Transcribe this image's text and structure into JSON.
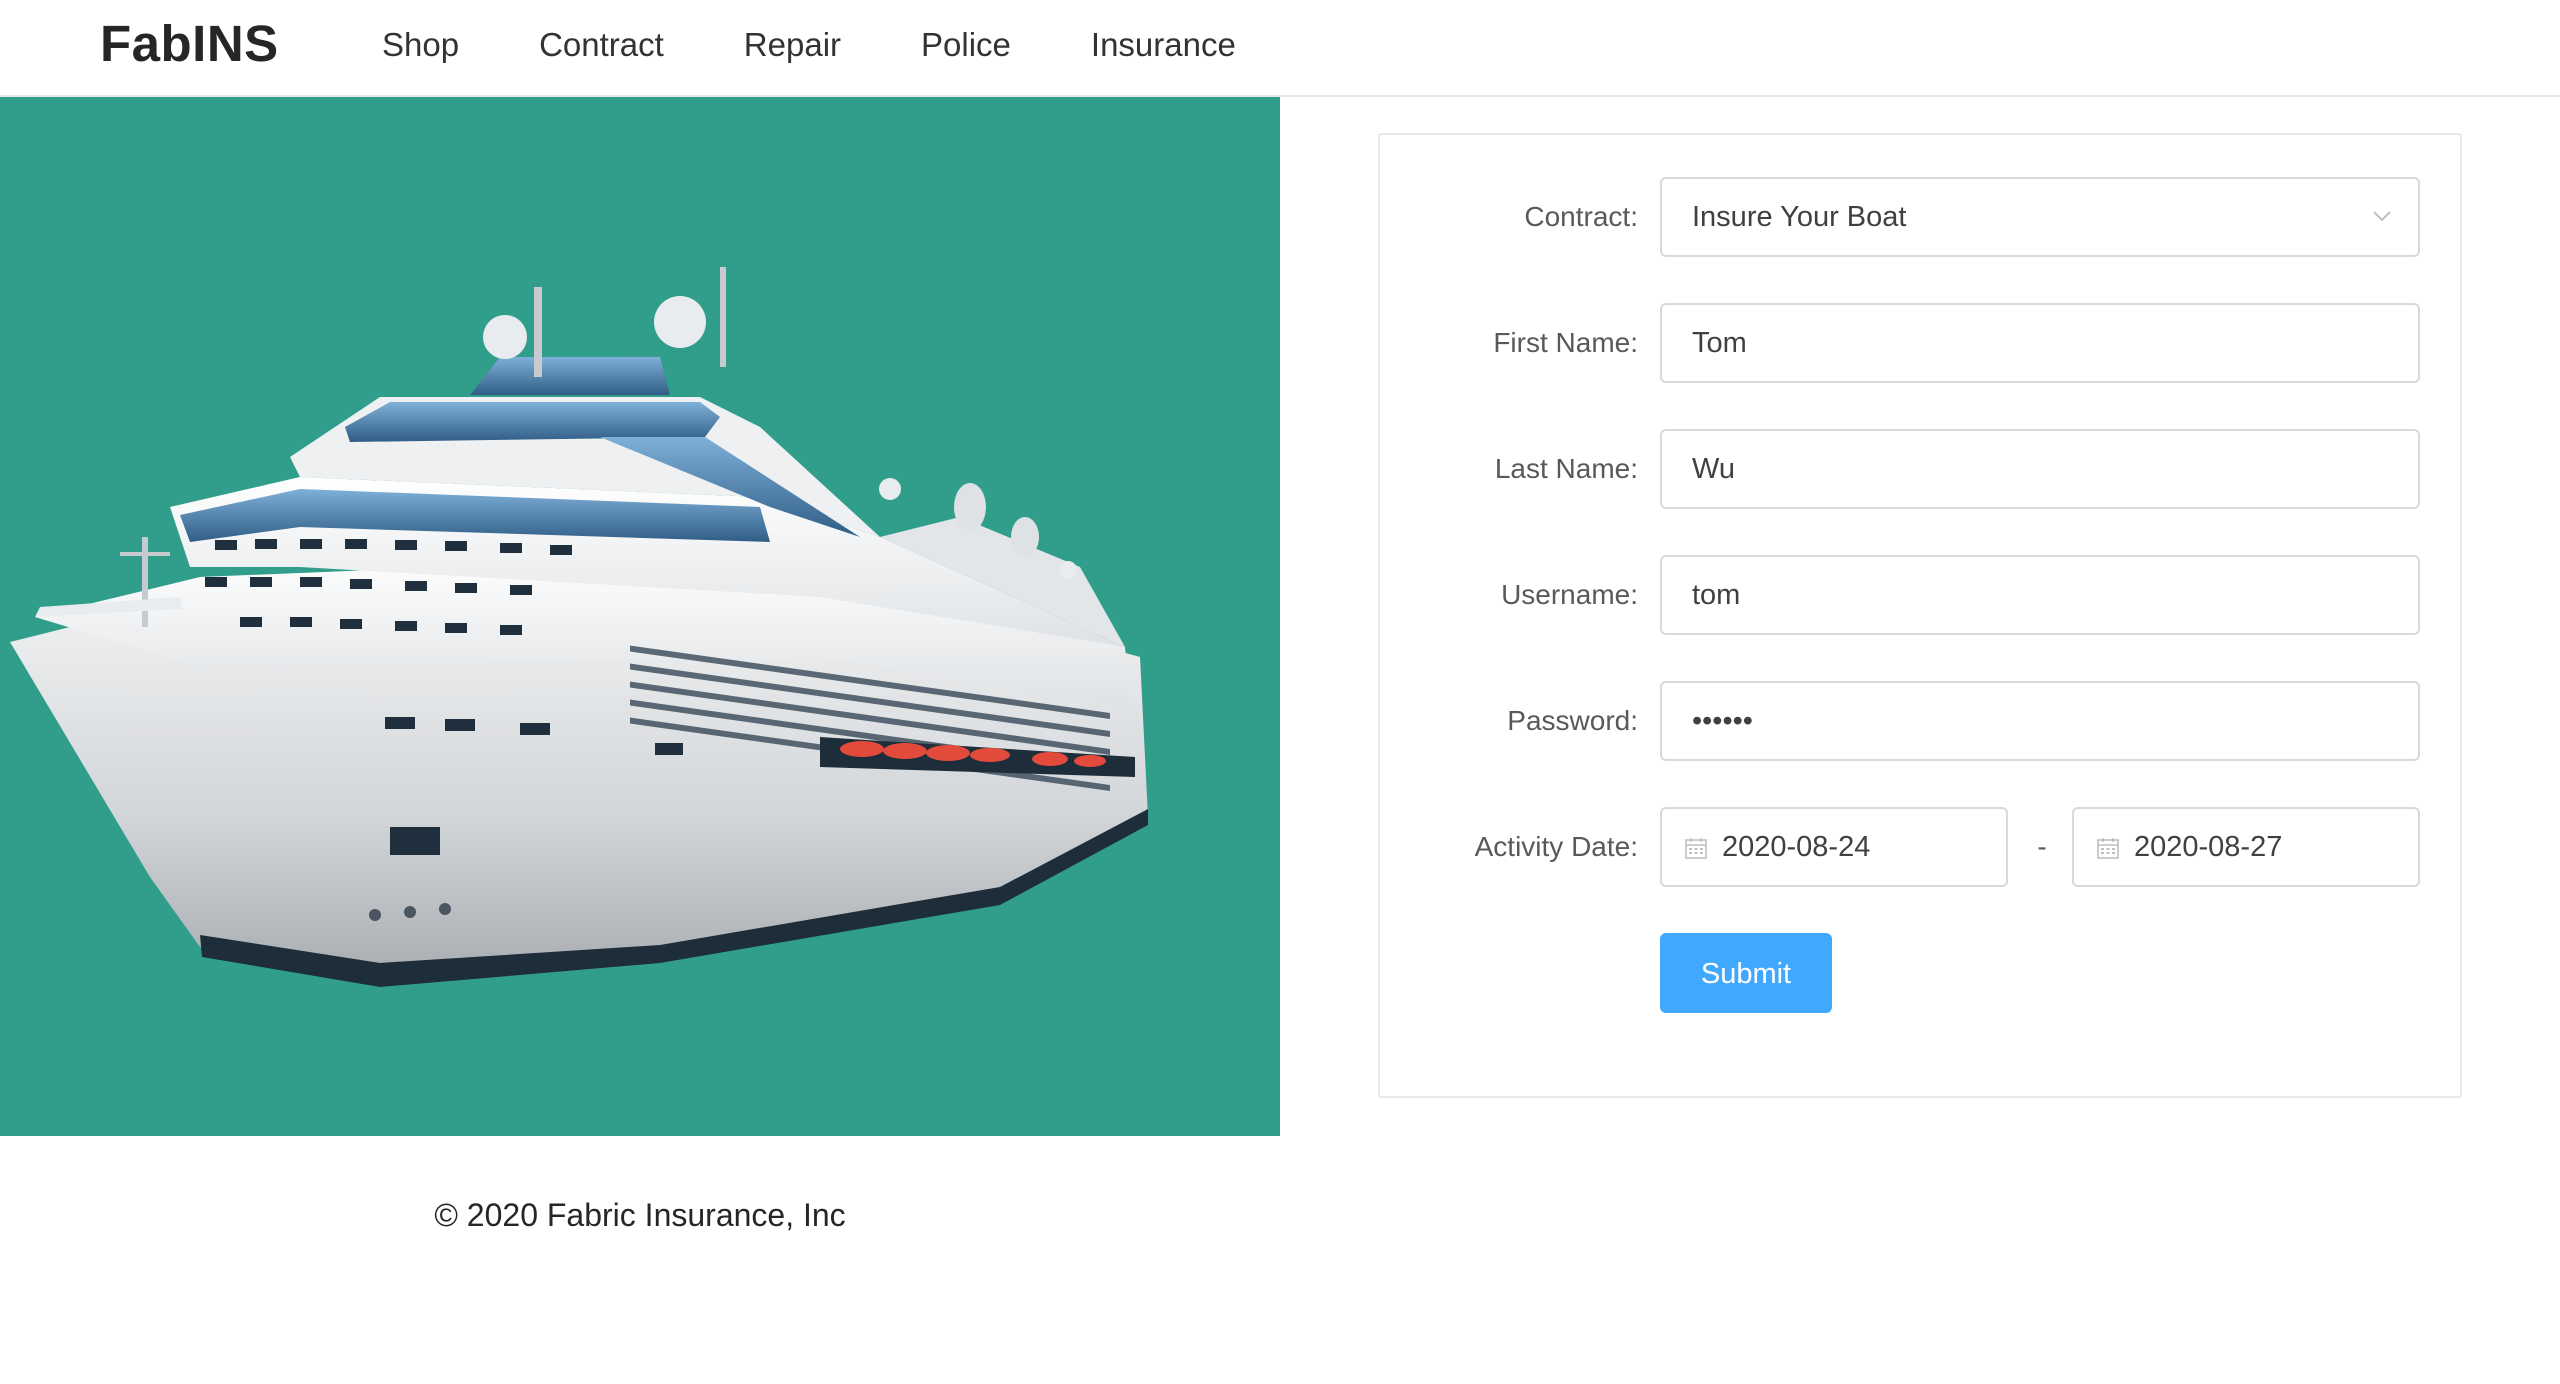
{
  "brand": "FabINS",
  "nav": {
    "items": [
      "Shop",
      "Contract",
      "Repair",
      "Police",
      "Insurance"
    ]
  },
  "hero": {
    "background_color": "#319e8c",
    "image_subject": "cruise-ship-illustration"
  },
  "form": {
    "contract": {
      "label": "Contract:",
      "value": "Insure Your Boat"
    },
    "first_name": {
      "label": "First Name:",
      "value": "Tom"
    },
    "last_name": {
      "label": "Last Name:",
      "value": "Wu"
    },
    "username": {
      "label": "Username:",
      "value": "tom"
    },
    "password": {
      "label": "Password:",
      "value": "••••••"
    },
    "activity_date": {
      "label": "Activity Date:",
      "start": "2020-08-24",
      "separator": "-",
      "end": "2020-08-27"
    },
    "submit_label": "Submit",
    "accent_color": "#40a9ff"
  },
  "footer": {
    "copyright": "© 2020 Fabric Insurance, Inc"
  }
}
